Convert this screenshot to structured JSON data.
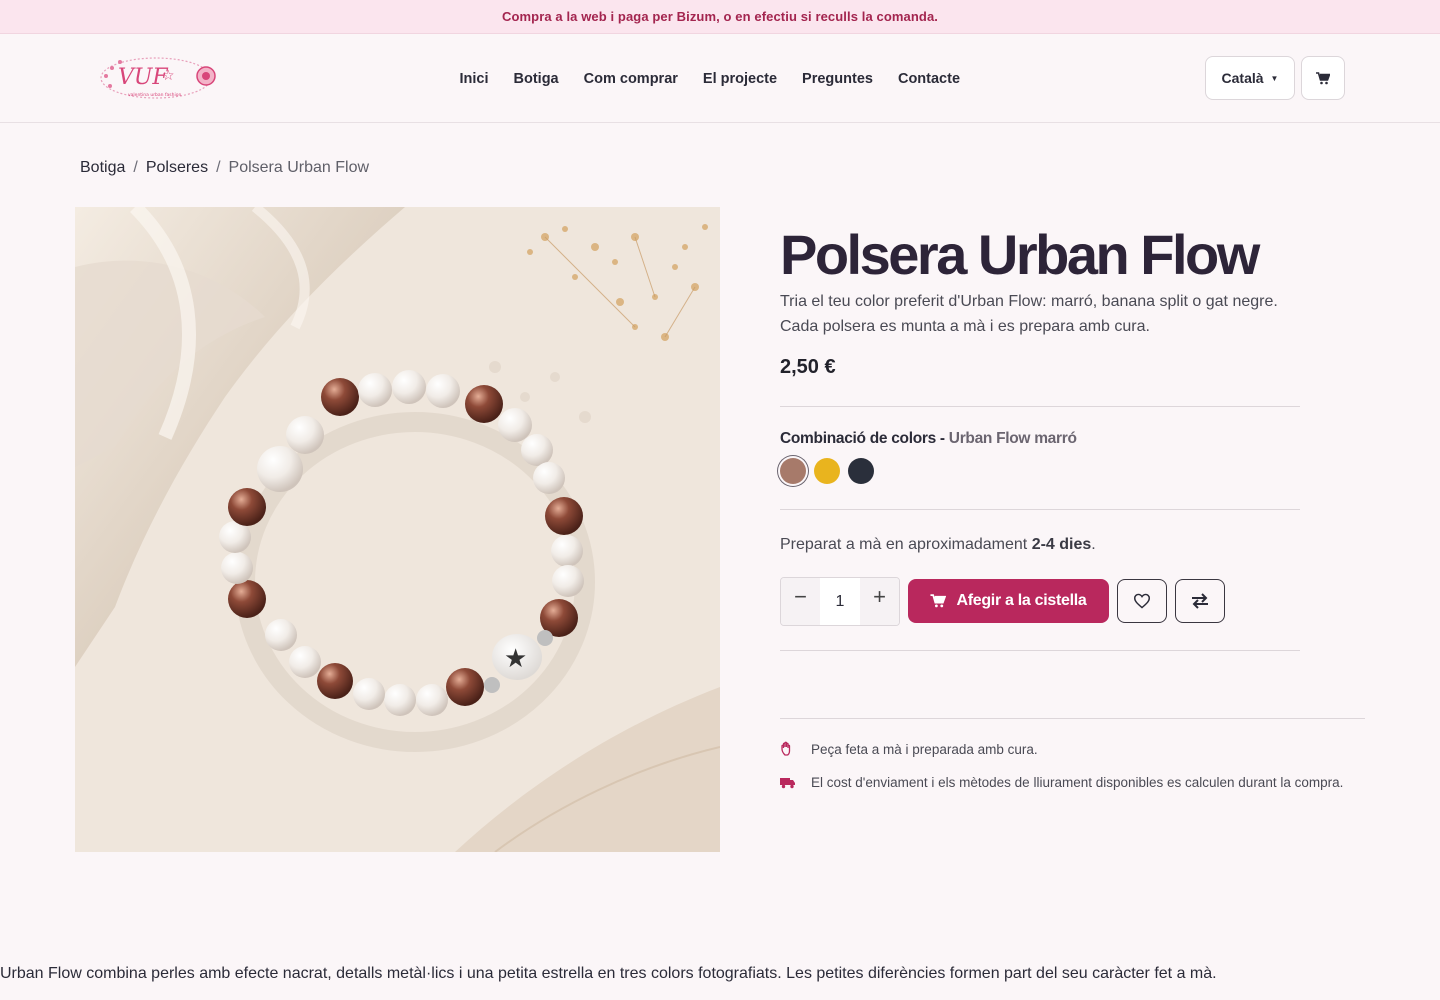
{
  "announcement": "Compra a la web i paga per Bizum, o en efectiu si reculls la comanda.",
  "brand": {
    "logo_text": "VUF",
    "logo_subtext": "valentina urban fashion",
    "accent_color": "#b9285d"
  },
  "nav": {
    "items": [
      {
        "label": "Inici"
      },
      {
        "label": "Botiga"
      },
      {
        "label": "Com comprar"
      },
      {
        "label": "El projecte"
      },
      {
        "label": "Preguntes"
      },
      {
        "label": "Contacte"
      }
    ],
    "language": "Català",
    "cart_icon": "cart-icon"
  },
  "breadcrumb": {
    "items": [
      {
        "label": "Botiga"
      },
      {
        "label": "Polseres"
      }
    ],
    "current": "Polsera Urban Flow",
    "separator": "/"
  },
  "product": {
    "title": "Polsera Urban Flow",
    "description": "Tria el teu color preferit d'Urban Flow: marró, banana split o gat negre. Cada polsera es munta a mà i es prepara amb cura.",
    "price": "2,50 €",
    "variant_label": "Combinació de colors",
    "variant_separator": " - ",
    "selected_variant": "Urban Flow marró",
    "swatches": [
      {
        "color": "#a77a6a",
        "selected": true
      },
      {
        "color": "#e9b41e",
        "selected": false
      },
      {
        "color": "#2a2f3b",
        "selected": false
      }
    ],
    "prep_prefix": "Preparat a mà en aproximadament ",
    "prep_days": "2-4 dies",
    "prep_suffix": ".",
    "quantity": "1",
    "add_to_cart": "Afegir a la cistella",
    "info": [
      {
        "icon": "hand-icon",
        "text": "Peça feta a mà i preparada amb cura."
      },
      {
        "icon": "truck-icon",
        "text": "El cost d'enviament i els mètodes de lliurament disponibles es calculen durant la compra."
      }
    ]
  },
  "long_description": "Urban Flow combina perles amb efecte nacrat, detalls metàl·lics i una petita estrella en tres colors fotografiats. Les petites diferències formen part del seu caràcter fet a mà."
}
